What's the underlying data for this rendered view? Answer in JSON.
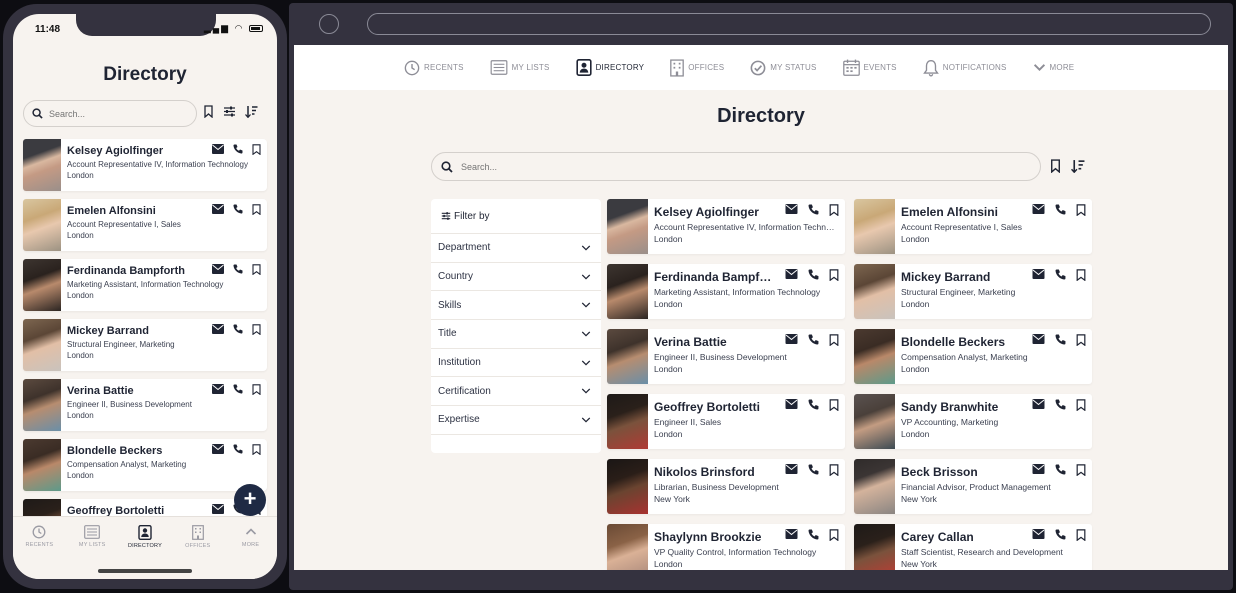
{
  "phone": {
    "status_time": "11:48",
    "title": "Directory",
    "search_placeholder": "Search...",
    "people": [
      {
        "name": "Kelsey Agiolfinger",
        "role": "Account Representative IV, Information Technology",
        "location": "London"
      },
      {
        "name": "Emelen Alfonsini",
        "role": "Account Representative I, Sales",
        "location": "London"
      },
      {
        "name": "Ferdinanda Bampforth",
        "role": "Marketing Assistant, Information Technology",
        "location": "London"
      },
      {
        "name": "Mickey Barrand",
        "role": "Structural Engineer, Marketing",
        "location": "London"
      },
      {
        "name": "Verina Battie",
        "role": "Engineer II, Business Development",
        "location": "London"
      },
      {
        "name": "Blondelle Beckers",
        "role": "Compensation Analyst, Marketing",
        "location": "London"
      },
      {
        "name": "Geoffrey Bortoletti",
        "role": "",
        "location": ""
      }
    ],
    "fab_label": "+",
    "tabs": [
      {
        "label": "RECENTS",
        "icon": "clock-icon",
        "active": false
      },
      {
        "label": "MY LISTS",
        "icon": "list-icon",
        "active": false
      },
      {
        "label": "DIRECTORY",
        "icon": "contact-card-icon",
        "active": true
      },
      {
        "label": "OFFICES",
        "icon": "building-icon",
        "active": false
      },
      {
        "label": "MORE",
        "icon": "chevron-up-icon",
        "active": false
      }
    ]
  },
  "browser": {
    "nav": [
      {
        "label": "RECENTS",
        "icon": "clock-icon",
        "active": false
      },
      {
        "label": "MY LISTS",
        "icon": "list-icon",
        "active": false
      },
      {
        "label": "DIRECTORY",
        "icon": "contact-card-icon",
        "active": true
      },
      {
        "label": "OFFICES",
        "icon": "building-icon",
        "active": false
      },
      {
        "label": "MY STATUS",
        "icon": "check-circle-icon",
        "active": false
      },
      {
        "label": "EVENTS",
        "icon": "calendar-icon",
        "active": false
      },
      {
        "label": "NOTIFICATIONS",
        "icon": "bell-icon",
        "active": false
      },
      {
        "label": "MORE",
        "icon": "chevron-down-icon",
        "active": false
      }
    ],
    "title": "Directory",
    "search_placeholder": "Search...",
    "filter": {
      "heading": "Filter by",
      "items": [
        "Department",
        "Country",
        "Skills",
        "Title",
        "Institution",
        "Certification",
        "Expertise"
      ]
    },
    "people": [
      {
        "name": "Kelsey Agiolfinger",
        "role": "Account Representative IV, Information Technology",
        "location": "London"
      },
      {
        "name": "Emelen Alfonsini",
        "role": "Account Representative I, Sales",
        "location": "London"
      },
      {
        "name": "Ferdinanda Bampforth",
        "role": "Marketing Assistant, Information Technology",
        "location": "London"
      },
      {
        "name": "Mickey Barrand",
        "role": "Structural Engineer, Marketing",
        "location": "London"
      },
      {
        "name": "Verina Battie",
        "role": "Engineer II, Business Development",
        "location": "London"
      },
      {
        "name": "Blondelle Beckers",
        "role": "Compensation Analyst, Marketing",
        "location": "London"
      },
      {
        "name": "Geoffrey Bortoletti",
        "role": "Engineer II, Sales",
        "location": "London"
      },
      {
        "name": "Sandy Branwhite",
        "role": "VP Accounting, Marketing",
        "location": "London"
      },
      {
        "name": "Nikolos Brinsford",
        "role": "Librarian, Business Development",
        "location": "New York"
      },
      {
        "name": "Beck Brisson",
        "role": "Financial Advisor, Product Management",
        "location": "New York"
      },
      {
        "name": "Shaylynn Brookzie",
        "role": "VP Quality Control, Information Technology",
        "location": "London"
      },
      {
        "name": "Carey Callan",
        "role": "Staff Scientist, Research and Development",
        "location": "New York"
      }
    ]
  }
}
